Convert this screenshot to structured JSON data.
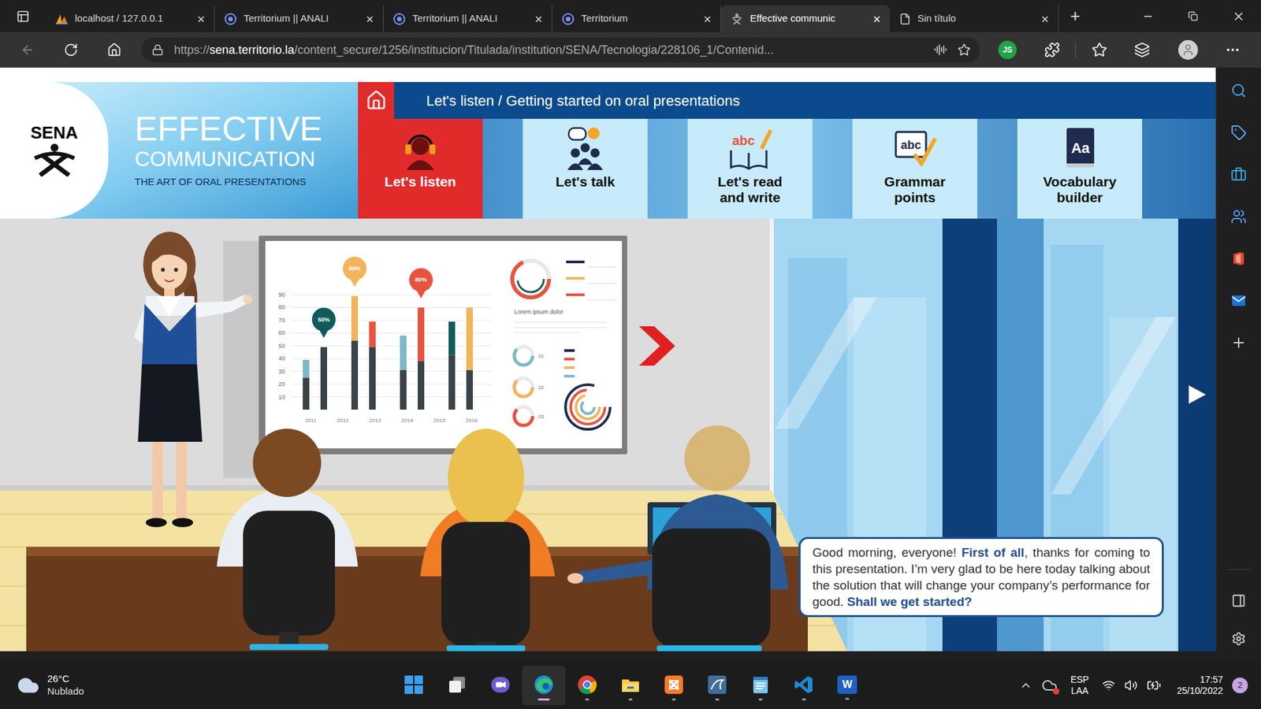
{
  "browser": {
    "tabs": [
      {
        "title": "localhost / 127.0.0.1",
        "close": "×",
        "selected": false
      },
      {
        "title": "Territorium || ANALI",
        "close": "×",
        "selected": false
      },
      {
        "title": "Territorium || ANALI",
        "close": "×",
        "selected": false
      },
      {
        "title": "Territorium",
        "close": "×",
        "selected": false
      },
      {
        "title": "Effective communic",
        "close": "×",
        "selected": true
      },
      {
        "title": "Sin título",
        "close": "×",
        "selected": false
      }
    ],
    "new_tab": "+",
    "back_enabled": false,
    "address": {
      "scheme": "https://",
      "host": "sena.territorio.la",
      "path": "/content_secure/1256/institucion/Titulada/institution/SENA/Tecnologia/228106_1/Contenid..."
    },
    "profile_badge": "JS"
  },
  "course": {
    "logo": "SENA",
    "title_line1": "EFFECTIVE",
    "title_line2": "COMMUNICATION",
    "subtitle": "THE ART OF ORAL PRESENTATIONS"
  },
  "breadcrumb": "Let's listen / Getting started on oral presentations",
  "sections": [
    {
      "label": "Let's listen",
      "selected": true
    },
    {
      "label": "Let's talk",
      "selected": false
    },
    {
      "label": "Let's read and write",
      "icon_text": "abc",
      "selected": false
    },
    {
      "label": "Grammar points",
      "icon_text": "abc",
      "selected": false
    },
    {
      "label": "Vocabulary builder",
      "icon_text": "Aa",
      "selected": false
    }
  ],
  "whiteboard": {
    "chart": {
      "y_ticks": [
        "90",
        "80",
        "70",
        "60",
        "50",
        "40",
        "30",
        "20",
        "10"
      ],
      "x_labels": [
        "2011",
        "2012",
        "2013",
        "2014",
        "2015",
        "2016"
      ],
      "bars": [
        {
          "base": 25,
          "top": 39,
          "color": "#7fb8c9"
        },
        {
          "base": 49,
          "top": 49,
          "color": "#3b4348"
        },
        {
          "base": 54,
          "top": 89,
          "color": "#f2b45a"
        },
        {
          "base": 49,
          "top": 69,
          "color": "#e8533f"
        },
        {
          "base": 31,
          "top": 58,
          "color": "#7fb8c9"
        },
        {
          "base": 38,
          "top": 80,
          "color": "#e8533f"
        },
        {
          "base": 43,
          "top": 69,
          "color": "#0f5b5b"
        },
        {
          "base": 31,
          "top": 80,
          "color": "#f2b45a"
        }
      ],
      "pins": [
        {
          "label": "50%",
          "bar": 1,
          "color": "#0f5b5b"
        },
        {
          "label": "90%",
          "bar": 2,
          "color": "#f2b45a"
        },
        {
          "label": "80%",
          "bar": 5,
          "color": "#e8533f"
        }
      ]
    },
    "title": "Lorem ipsum dolor",
    "items": [
      "01",
      "02",
      "03"
    ]
  },
  "speech": {
    "segments": [
      {
        "text": "Good morning, everyone! ",
        "bold": false
      },
      {
        "text": "First of all",
        "bold": true
      },
      {
        "text": ", thanks for coming to this presentation. I’m very glad to be here today talking about the solution that will change your company’s performance for good. ",
        "bold": false
      },
      {
        "text": "Shall we get started?",
        "bold": true
      }
    ]
  },
  "taskbar": {
    "weather": {
      "temp": "26°C",
      "condition": "Nublado"
    },
    "apps": [
      {
        "running": false,
        "active": false
      },
      {
        "running": false,
        "active": false
      },
      {
        "running": false,
        "active": false
      },
      {
        "running": true,
        "active": true
      },
      {
        "running": true,
        "active": false
      },
      {
        "running": true,
        "active": false
      },
      {
        "running": true,
        "active": false
      },
      {
        "running": true,
        "active": false
      },
      {
        "running": true,
        "active": false
      },
      {
        "running": true,
        "active": false
      },
      {
        "running": true,
        "active": false,
        "glyph": "W"
      }
    ],
    "tray": {
      "lang": "ESP",
      "layout": "LAA",
      "time": "17:57",
      "date": "25/10/2022",
      "notifications": "2"
    }
  }
}
